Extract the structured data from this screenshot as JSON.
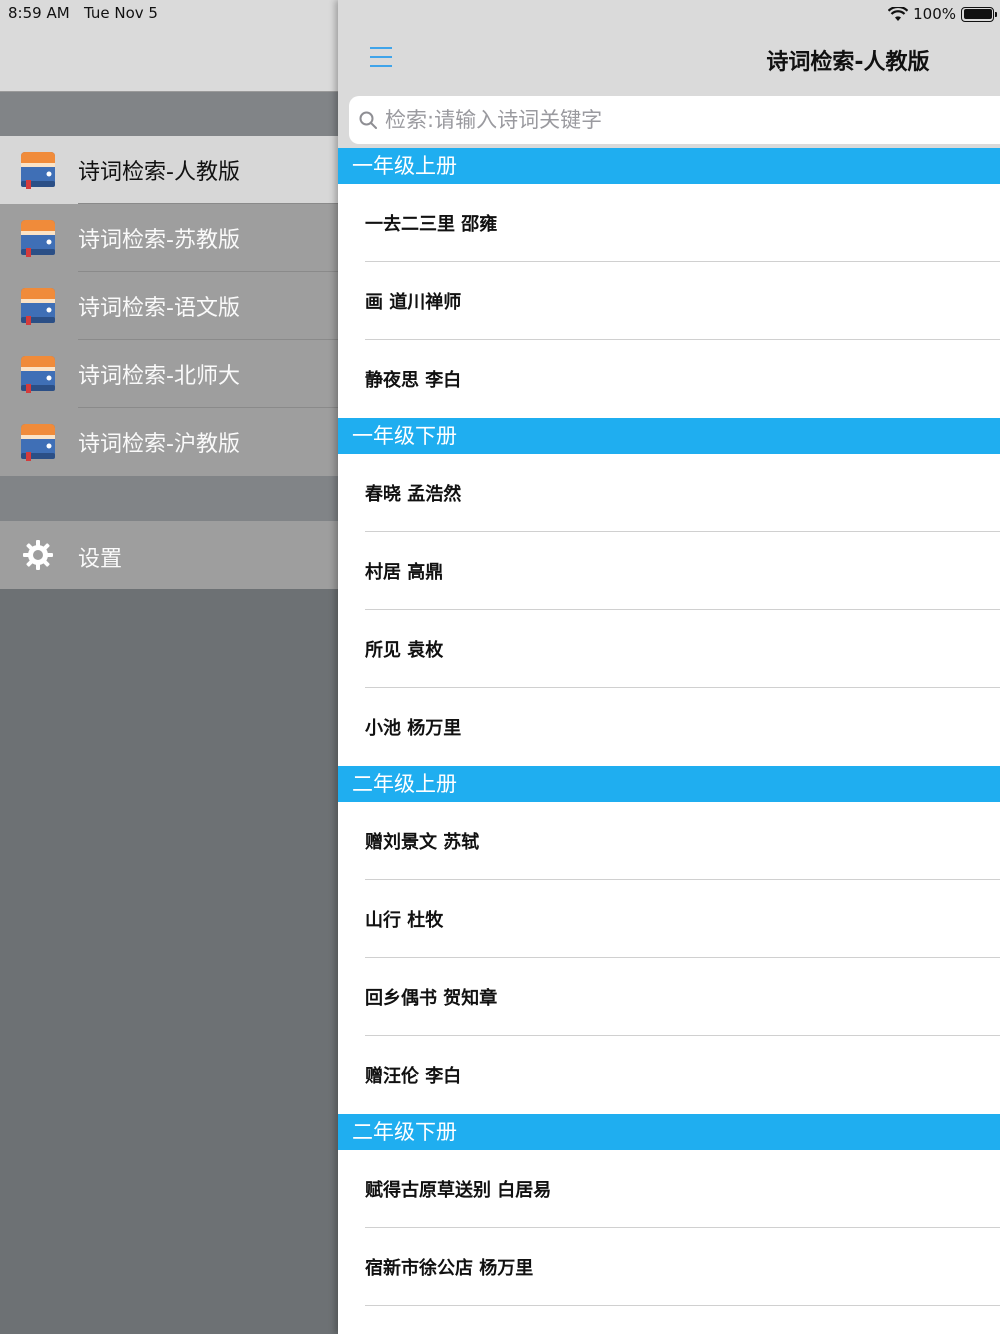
{
  "status_bar": {
    "time": "8:59 AM",
    "date": "Tue Nov 5",
    "battery": "100%"
  },
  "sidebar": {
    "items": [
      {
        "label": "诗词检索-人教版",
        "selected": true
      },
      {
        "label": "诗词检索-苏教版",
        "selected": false
      },
      {
        "label": "诗词检索-语文版",
        "selected": false
      },
      {
        "label": "诗词检索-北师大",
        "selected": false
      },
      {
        "label": "诗词检索-沪教版",
        "selected": false
      }
    ],
    "settings_label": "设置"
  },
  "nav": {
    "title": "诗词检索-人教版"
  },
  "search": {
    "placeholder": "检索:请输入诗词关键字",
    "value": ""
  },
  "sections": [
    {
      "title": "一年级上册",
      "rows": [
        "一去二三里  邵雍",
        "画  道川禅师",
        "静夜思  李白"
      ]
    },
    {
      "title": "一年级下册",
      "rows": [
        "春晓  孟浩然",
        "村居  高鼎",
        "所见  袁枚",
        "小池  杨万里"
      ]
    },
    {
      "title": "二年级上册",
      "rows": [
        "赠刘景文  苏轼",
        "山行  杜牧",
        "回乡偶书  贺知章",
        "赠汪伦  李白"
      ]
    },
    {
      "title": "二年级下册",
      "rows": [
        "赋得古原草送别  白居易",
        "宿新市徐公店  杨万里"
      ]
    }
  ],
  "colors": {
    "accent": "#1faef0",
    "hamburger": "#3fa4ea",
    "sidebar_bg": "#6d7174",
    "sidebar_item": "#9e9e9e",
    "sidebar_selected": "#d7d7d7"
  }
}
